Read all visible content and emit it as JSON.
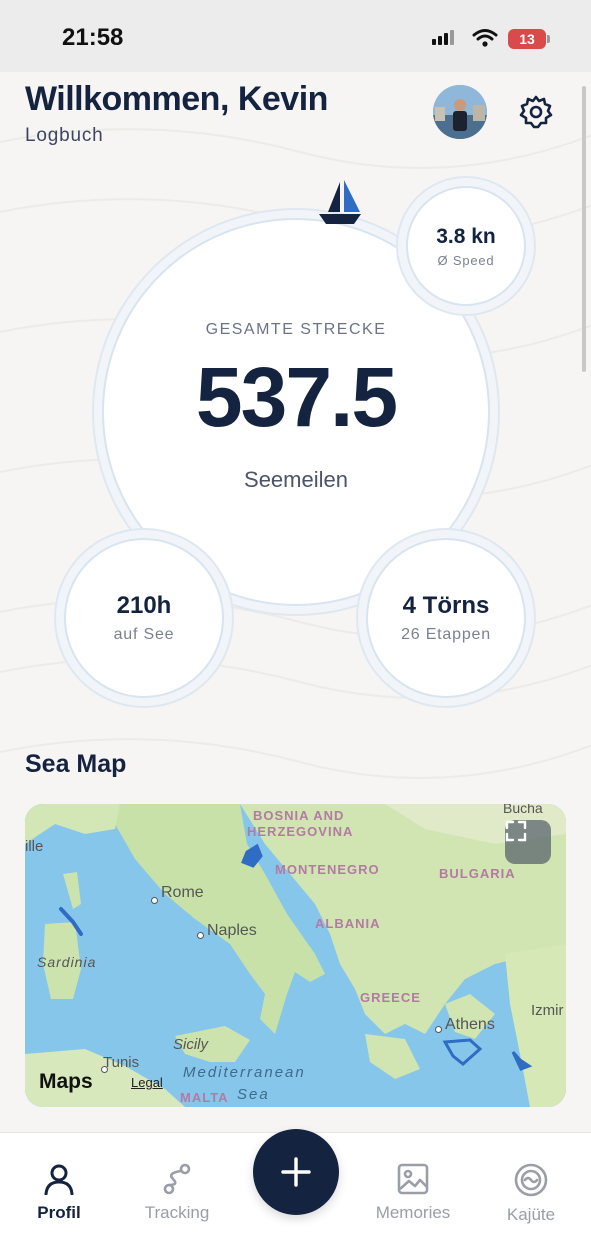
{
  "status_bar": {
    "time": "21:58",
    "battery": "13"
  },
  "header": {
    "title": "Willkommen, Kevin",
    "subtitle": "Logbuch",
    "avatar_icon": "profile-photo",
    "settings_icon": "gear-icon"
  },
  "stats": {
    "total": {
      "label": "GESAMTE STRECKE",
      "value": "537.5",
      "unit": "Seemeilen"
    },
    "speed": {
      "value": "3.8 kn",
      "label": "Ø Speed"
    },
    "hours": {
      "value": "210h",
      "label": "auf See"
    },
    "trips": {
      "value": "4 Törns",
      "label": "26 Etappen"
    }
  },
  "sea_map": {
    "title": "Sea Map",
    "countries": [
      "BOSNIA AND",
      "HERZEGOVINA",
      "MONTENEGRO",
      "BULGARIA",
      "ALBANIA",
      "GREECE",
      "MALTA"
    ],
    "cities": [
      "Rome",
      "Naples",
      "Sardinia",
      "Sicily",
      "Tunis",
      "Athens",
      "Izmir",
      "ille",
      "Bucha"
    ],
    "seas": [
      "Mediterranean",
      "Sea"
    ],
    "attribution": "Maps",
    "legal": "Legal"
  },
  "tabs": [
    {
      "label": "Profil",
      "icon": "person-icon",
      "active": true
    },
    {
      "label": "Tracking",
      "icon": "route-icon",
      "active": false
    },
    {
      "label": "Memories",
      "icon": "photo-icon",
      "active": false
    },
    {
      "label": "Kajüte",
      "icon": "lifebuoy-icon",
      "active": false
    }
  ],
  "colors": {
    "navy": "#14233f",
    "background": "#f6f5f3",
    "track": "#2f6cc4"
  }
}
